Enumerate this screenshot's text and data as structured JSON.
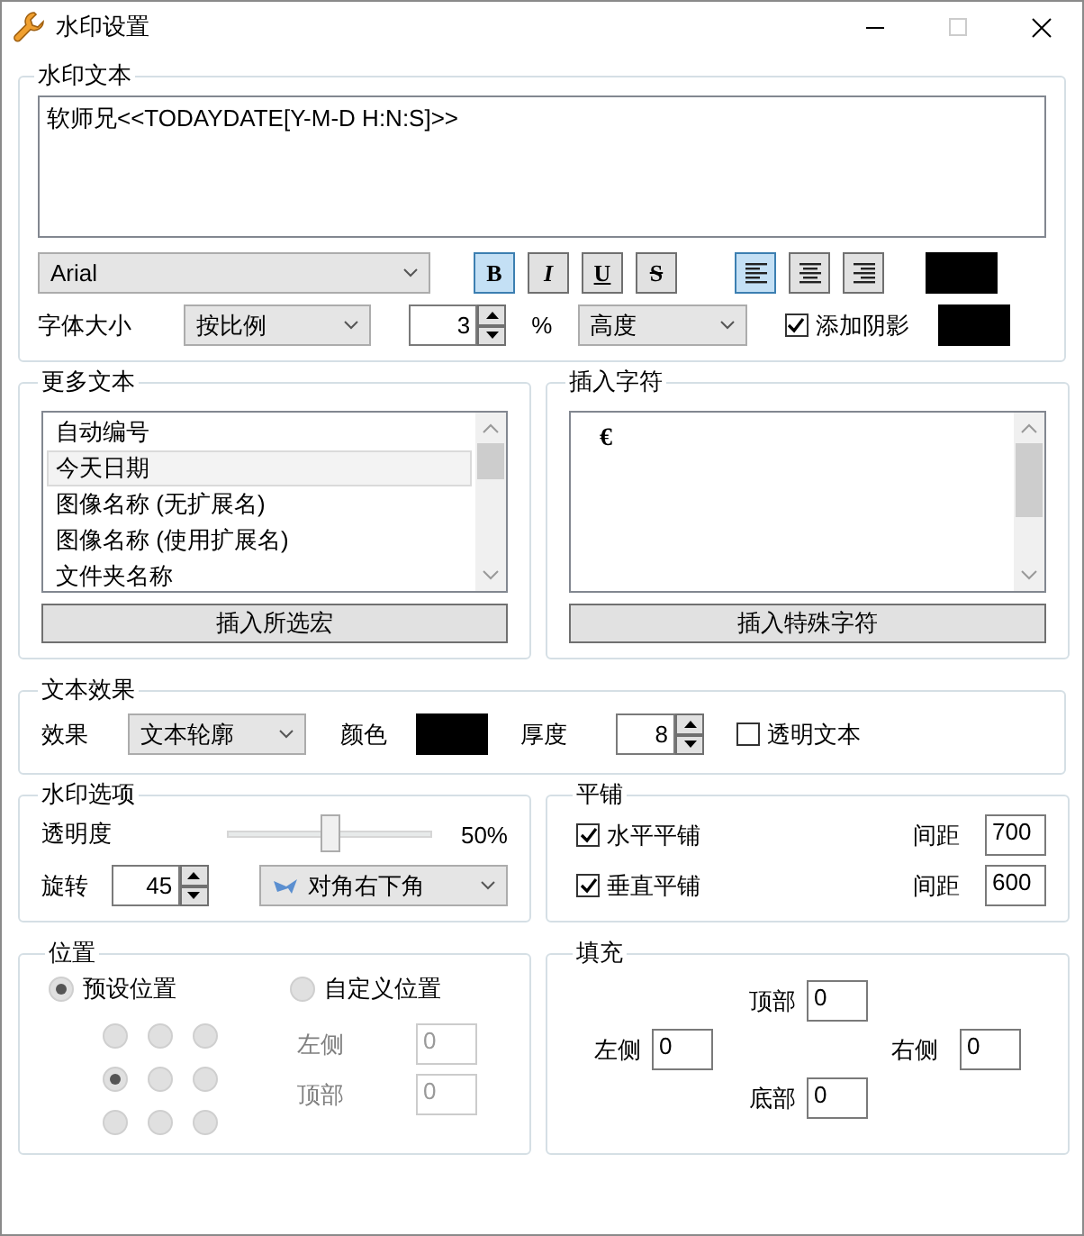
{
  "window": {
    "title": "水印设置"
  },
  "watermark_text": {
    "title": "水印文本",
    "text": "软师兄<<TODAYDATE[Y-M-D H:N:S]>>",
    "font": "Arial",
    "styles": [
      {
        "label": "B",
        "kind": "bold",
        "selected": true
      },
      {
        "label": "I",
        "kind": "italic",
        "selected": false
      },
      {
        "label": "U",
        "kind": "underline",
        "selected": false
      },
      {
        "label": "S",
        "kind": "strike",
        "selected": false
      }
    ],
    "alignments": [
      {
        "kind": "left",
        "selected": true
      },
      {
        "kind": "center",
        "selected": false
      },
      {
        "kind": "right",
        "selected": false
      }
    ],
    "text_color": {
      "color": "#000000"
    },
    "size_label": "字体大小",
    "size_mode": "按比例",
    "size_value": "3",
    "percent": "%",
    "size_basis": "高度",
    "shadow": {
      "label": "添加阴影",
      "checked": true,
      "color": "#000000"
    }
  },
  "more_text": {
    "title": "更多文本",
    "items": [
      {
        "label": "自动编号",
        "selected": false
      },
      {
        "label": "今天日期",
        "selected": true
      },
      {
        "label": "图像名称 (无扩展名)",
        "selected": false
      },
      {
        "label": "图像名称 (使用扩展名)",
        "selected": false
      },
      {
        "label": "文件夹名称",
        "selected": false
      }
    ],
    "button": "插入所选宏"
  },
  "insert_char": {
    "title": "插入字符",
    "items": [
      {
        "label": "€"
      }
    ],
    "button": "插入特殊字符"
  },
  "text_effect": {
    "title": "文本效果",
    "effect_label": "效果",
    "effect": "文本轮廓",
    "color_label": "颜色",
    "color": "#000000",
    "thickness_label": "厚度",
    "thickness": "8",
    "transparent": {
      "label": "透明文本",
      "checked": false
    }
  },
  "options": {
    "title": "水印选项",
    "opacity_label": "透明度",
    "opacity": {
      "level": 0.5
    },
    "opacity_reading": "50%",
    "rotate_label": "旋转",
    "rotate": "45",
    "direction": "对角右下角"
  },
  "tiling": {
    "title": "平铺",
    "rows": [
      {
        "label": "水平平铺",
        "checked": true,
        "spacing_label": "间距",
        "spacing": "700"
      },
      {
        "label": "垂直平铺",
        "checked": true,
        "spacing_label": "间距",
        "spacing": "600"
      }
    ]
  },
  "position": {
    "title": "位置",
    "modes": [
      {
        "label": "预设位置",
        "selected": true
      },
      {
        "label": "自定义位置",
        "selected": false
      }
    ],
    "grid": [
      {
        "selected": false
      },
      {
        "selected": false
      },
      {
        "selected": false
      },
      {
        "selected": true
      },
      {
        "selected": false
      },
      {
        "selected": false
      },
      {
        "selected": false
      },
      {
        "selected": false
      },
      {
        "selected": false
      }
    ],
    "fields": [
      {
        "label": "左侧",
        "value": "0",
        "disabled": true
      },
      {
        "label": "顶部",
        "value": "0",
        "disabled": true
      }
    ]
  },
  "padding": {
    "title": "填充",
    "top": {
      "label": "顶部",
      "value": "0"
    },
    "left": {
      "label": "左侧",
      "value": "0"
    },
    "right": {
      "label": "右侧",
      "value": "0"
    },
    "bottom": {
      "label": "底部",
      "value": "0"
    }
  }
}
